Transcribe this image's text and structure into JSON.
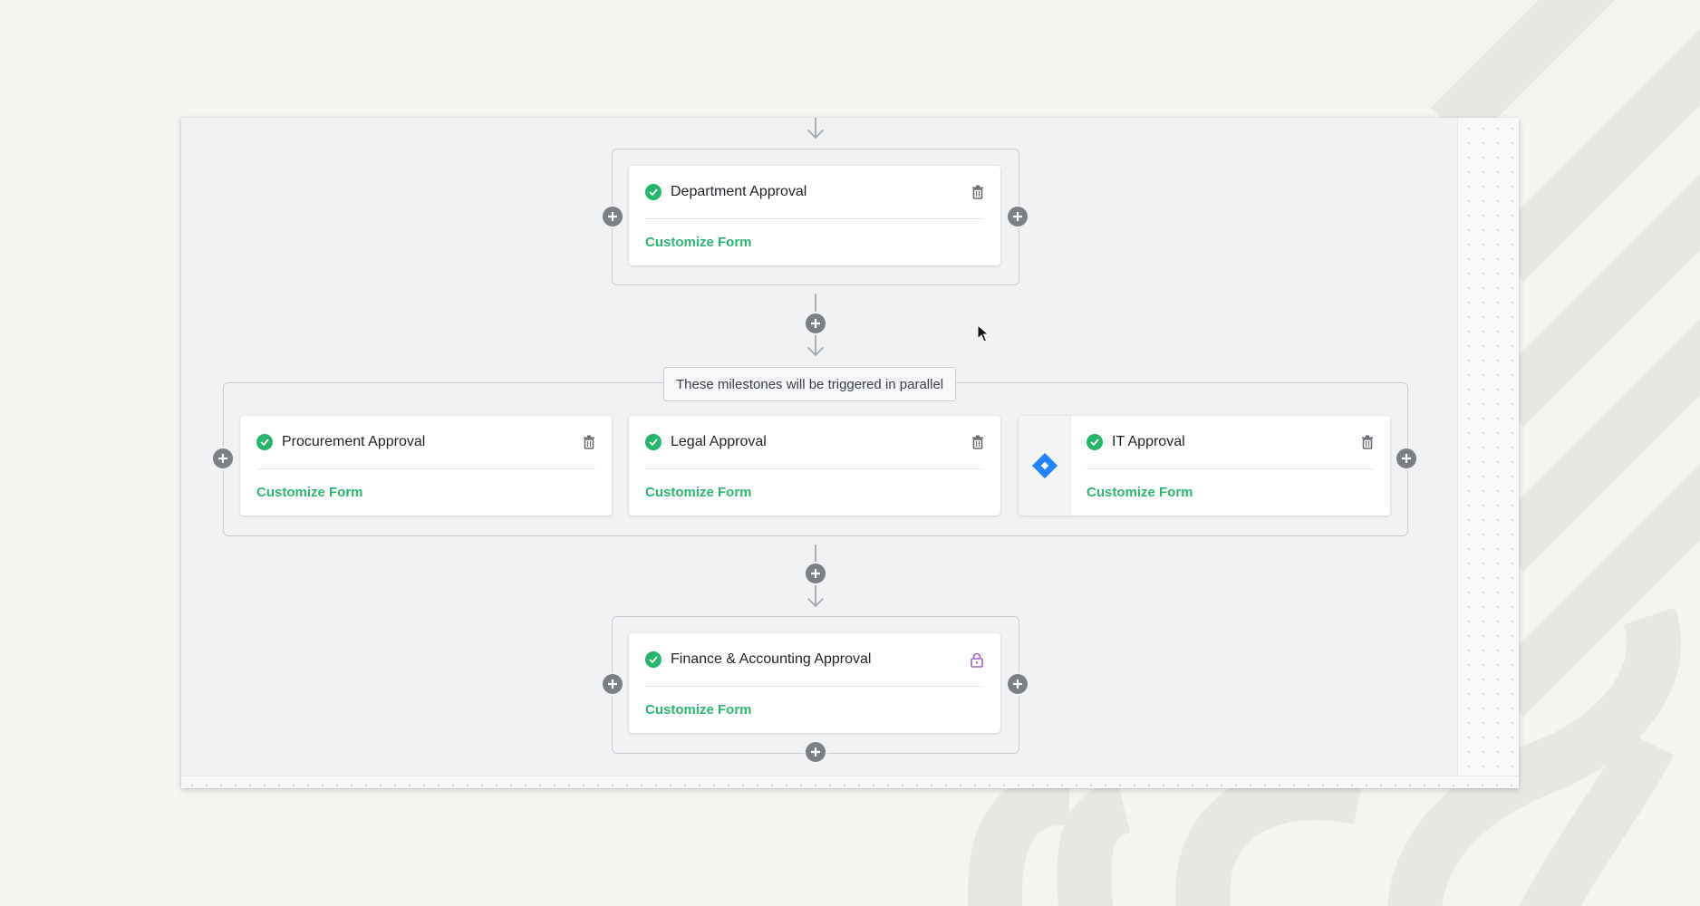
{
  "colors": {
    "page_background": "#f5f4f1",
    "canvas_background": "#f0f2f4",
    "accent_green": "#2bb673",
    "check_green": "#27b56b",
    "plus_grey": "#7c7f84",
    "jira_blue": "#2684ff",
    "lock_purple": "#a45ec6"
  },
  "workflow": {
    "department": {
      "title": "Department Approval",
      "status_icon": "check-circle-icon",
      "action_icon": "trash-icon",
      "link": "Customize Form"
    },
    "parallel_group": {
      "label": "These milestones will be triggered in parallel",
      "cards": [
        {
          "title": "Procurement Approval",
          "status_icon": "check-circle-icon",
          "action_icon": "trash-icon",
          "link": "Customize Form"
        },
        {
          "title": "Legal Approval",
          "status_icon": "check-circle-icon",
          "action_icon": "trash-icon",
          "link": "Customize Form"
        },
        {
          "title": "IT Approval",
          "status_icon": "check-circle-icon",
          "action_icon": "trash-icon",
          "integration_icon": "jira-icon",
          "link": "Customize Form"
        }
      ]
    },
    "finance": {
      "title": "Finance & Accounting Approval",
      "status_icon": "check-circle-icon",
      "action_icon": "lock-icon",
      "link": "Customize Form"
    }
  }
}
